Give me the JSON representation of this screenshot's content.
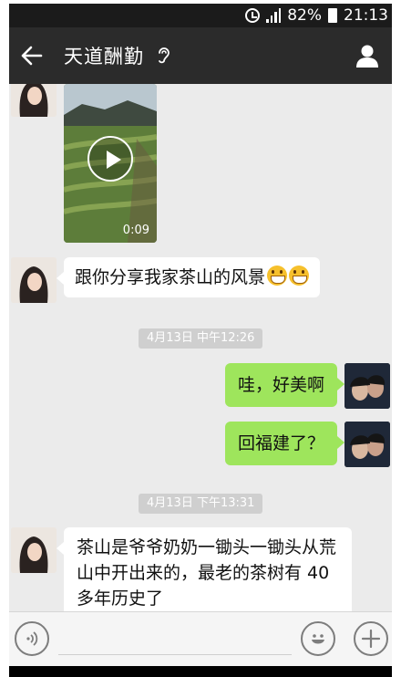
{
  "status_bar": {
    "battery": "82%",
    "time": "21:13",
    "icons": [
      "alarm-icon",
      "signal-icon",
      "battery-icon"
    ]
  },
  "header": {
    "title": "天道酬勤",
    "icons": [
      "back-arrow-icon",
      "earpiece-icon",
      "profile-icon"
    ]
  },
  "messages": [
    {
      "type": "video",
      "direction": "incoming",
      "duration": "0:09"
    },
    {
      "type": "text",
      "direction": "incoming",
      "text": "跟你分享我家茶山的风景",
      "emoji": [
        "grinning-emoji",
        "grinning-emoji"
      ]
    },
    {
      "type": "timestamp",
      "text": "4月13日 中午12:26"
    },
    {
      "type": "text",
      "direction": "outgoing",
      "text": "哇，好美啊"
    },
    {
      "type": "text",
      "direction": "outgoing",
      "text": "回福建了？"
    },
    {
      "type": "timestamp",
      "text": "4月13日 下午13:31"
    },
    {
      "type": "text",
      "direction": "incoming",
      "lines": [
        "茶山是爷爷奶奶一锄头一锄头从荒",
        "山中开出来的，最老的茶树有 40",
        "多年历史了"
      ]
    }
  ],
  "input_bar": {
    "icons": [
      "voice-icon",
      "emoji-icon",
      "plus-icon"
    ]
  },
  "colors": {
    "header_bg": "#2b2b2b",
    "chat_bg": "#ebebeb",
    "outgoing_bubble": "#9ee55c",
    "incoming_bubble": "#ffffff"
  }
}
